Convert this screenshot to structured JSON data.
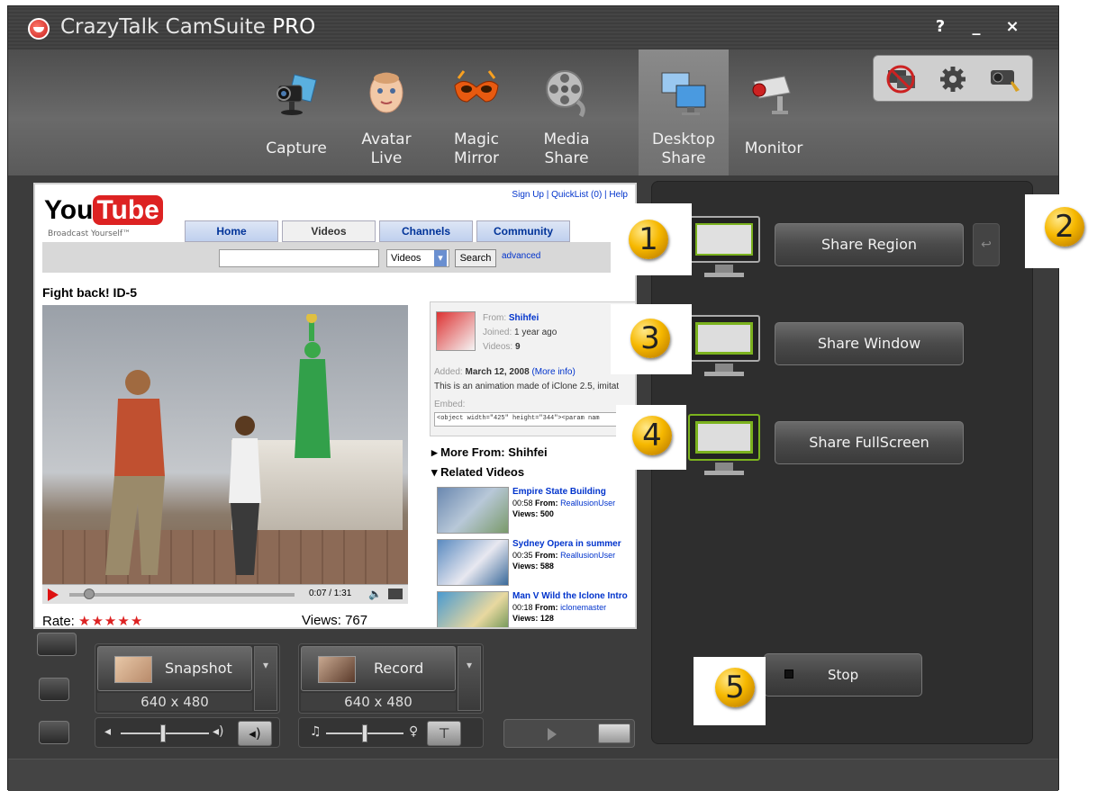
{
  "app": {
    "title_main": "CrazyTalk CamSuite",
    "title_suffix": "PRO",
    "help_label": "?",
    "minimize_label": "_",
    "close_label": "×"
  },
  "modes": [
    {
      "label": "Capture",
      "icon": "webcam-icon"
    },
    {
      "label": "Avatar\nLive",
      "icon": "baby-face-icon"
    },
    {
      "label": "Magic\nMirror",
      "icon": "mask-icon"
    },
    {
      "label": "Media\nShare",
      "icon": "film-reel-icon"
    },
    {
      "label": "Desktop\nShare",
      "icon": "monitors-icon",
      "active": true
    },
    {
      "label": "Monitor",
      "icon": "security-camera-icon"
    }
  ],
  "tools": [
    "no-sharing-icon",
    "gear-icon",
    "camera-settings-icon"
  ],
  "youtube": {
    "logo_you": "You",
    "logo_tube": "Tube",
    "tagline": "Broadcast Yourself™",
    "top_links": "Sign Up | QuickList (0) | Help",
    "tabs": [
      "Home",
      "Videos",
      "Channels",
      "Community"
    ],
    "search_category": "Videos",
    "search_button": "Search",
    "advanced_link": "advanced",
    "video_title": "Fight back! ID-5",
    "time": "0:07 / 1:31",
    "rate_label": "Rate:",
    "stars": "★★★★★",
    "views_label": "Views:",
    "views_count": "767",
    "from_label": "From:",
    "from_user": "Shihfei",
    "joined_label": "Joined:",
    "joined_value": "1 year ago",
    "videos_label": "Videos:",
    "videos_count": "9",
    "added_label": "Added:",
    "added_date": "March 12, 2008",
    "more_info": "(More info)",
    "description": "This is an animation made of iClone 2.5, imitat",
    "embed_label": "Embed:",
    "embed_code": "<object width=\"425\" height=\"344\"><param nam",
    "more_from": "More From: Shihfei",
    "related_heading": "Related Videos",
    "related": [
      {
        "title": "Empire State Building",
        "duration": "00:58",
        "from_label": "From:",
        "from": "ReallusionUser",
        "views": "Views: 500"
      },
      {
        "title": "Sydney Opera in summer",
        "duration": "00:35",
        "from_label": "From:",
        "from": "ReallusionUser",
        "views": "Views: 588"
      },
      {
        "title": "Man V Wild the Iclone Intro",
        "duration": "00:18",
        "from_label": "From:",
        "from": "iclonemaster",
        "views": "Views: 128"
      }
    ]
  },
  "share": {
    "region_label": "Share Region",
    "window_label": "Share Window",
    "fullscreen_label": "Share FullScreen",
    "stop_label": "Stop",
    "badges": [
      "1",
      "2",
      "3",
      "4",
      "5"
    ]
  },
  "capture": {
    "snapshot_label": "Snapshot",
    "snapshot_res": "640 x 480",
    "record_label": "Record",
    "record_res": "640 x 480"
  },
  "colors": {
    "accent_green": "#7bb21e",
    "badge_gold": "#f6b800",
    "youtube_red": "#dd2222"
  }
}
